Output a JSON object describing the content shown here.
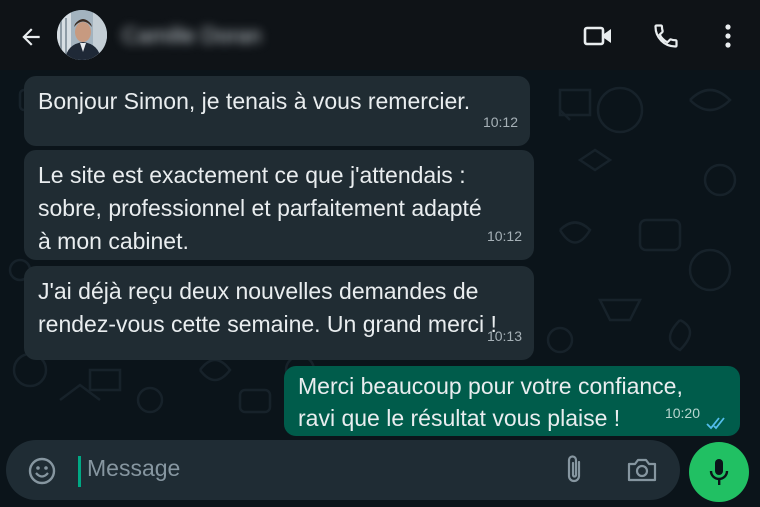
{
  "colors": {
    "accent": "#21c063",
    "incoming_bubble": "#202c33",
    "outgoing_bubble": "#005c4b",
    "read_ticks": "#53bdeb"
  },
  "header": {
    "back_icon": "arrow-left-icon",
    "contact_name": "Camille Doran",
    "video_call_icon": "video-camera-icon",
    "voice_call_icon": "phone-icon",
    "menu_icon": "more-vertical-icon"
  },
  "messages": [
    {
      "direction": "in",
      "text": "Bonjour Simon, je tenais à vous remercier.",
      "time": "10:12"
    },
    {
      "direction": "in",
      "text": "Le site est exactement ce que j'attendais :\nsobre, professionnel et parfaitement adapté\nà mon cabinet.",
      "time": "10:12"
    },
    {
      "direction": "in",
      "text": "J'ai déjà reçu deux nouvelles demandes de\nrendez-vous cette semaine. Un grand merci !",
      "time": "10:13"
    },
    {
      "direction": "out",
      "text": "Merci beaucoup pour votre confiance,\nravi que le résultat vous plaise !",
      "time": "10:20",
      "status": "read"
    }
  ],
  "composer": {
    "placeholder": "Message",
    "emoji_icon": "emoji-icon",
    "attach_icon": "paperclip-icon",
    "camera_icon": "camera-icon",
    "mic_icon": "microphone-icon"
  }
}
